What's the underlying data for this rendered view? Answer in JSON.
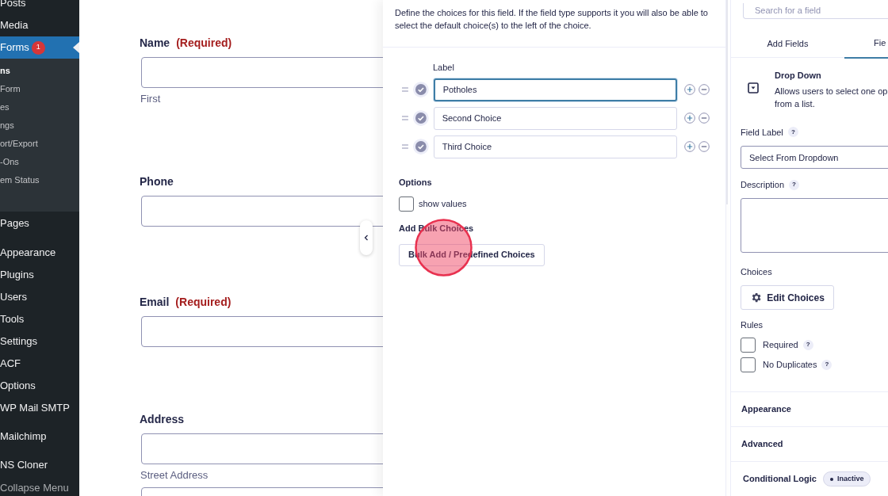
{
  "sidebar": {
    "items": [
      {
        "label": "Posts",
        "selected": false
      },
      {
        "label": "Media",
        "selected": false
      },
      {
        "label": "Forms",
        "selected": true,
        "badge": "1",
        "children": [
          {
            "label": "ns",
            "selected": true
          },
          {
            "label": "Form",
            "selected": false
          },
          {
            "label": "es",
            "selected": false
          },
          {
            "label": "ngs",
            "selected": false
          },
          {
            "label": "ort/Export",
            "selected": false
          },
          {
            "label": "-Ons",
            "selected": false
          },
          {
            "label": "em Status",
            "selected": false
          }
        ]
      },
      {
        "label": "Pages",
        "selected": false
      },
      {
        "label": "Appearance",
        "selected": false
      },
      {
        "label": "Plugins",
        "selected": false
      },
      {
        "label": "Users",
        "selected": false
      },
      {
        "label": "Tools",
        "selected": false
      },
      {
        "label": "Settings",
        "selected": false
      },
      {
        "label": "ACF",
        "selected": false
      },
      {
        "label": "Options",
        "selected": false
      },
      {
        "label": "WP Mail SMTP",
        "selected": false
      },
      {
        "label": "Mailchimp",
        "selected": false
      },
      {
        "label": "NS Cloner",
        "selected": false
      },
      {
        "label": "Collapse Menu",
        "selected": false,
        "kind": "collapse"
      }
    ]
  },
  "form": {
    "fields": [
      {
        "label": "Name",
        "required": "(Required)",
        "inputs": [
          {
            "kind": "text",
            "sublabel": "First"
          }
        ]
      },
      {
        "label": "Phone",
        "inputs": [
          {
            "kind": "text"
          }
        ]
      },
      {
        "label": "Email",
        "required": "(Required)",
        "inputs": [
          {
            "kind": "text"
          }
        ]
      },
      {
        "label": "Address",
        "inputs": [
          {
            "kind": "text",
            "sublabel": "Street Address"
          },
          {
            "kind": "text"
          }
        ]
      }
    ]
  },
  "choices_panel": {
    "description": "Define the choices for this field. If the field type supports it you will also be able to select the default choice(s) to the left of the choice.",
    "column_label": "Label",
    "choices": [
      {
        "value": "Potholes",
        "focused": true
      },
      {
        "value": "Second Choice",
        "focused": false
      },
      {
        "value": "Third Choice",
        "focused": false
      }
    ],
    "options_heading": "Options",
    "show_values": {
      "label": "show values",
      "checked": false
    },
    "bulk_heading": "Add Bulk Choices",
    "bulk_button": "Bulk Add / Predefined Choices"
  },
  "settings_panel": {
    "search": {
      "placeholder": "Search for a field"
    },
    "tabs": [
      {
        "label": "Add Fields",
        "selected": false
      },
      {
        "label": "Fie",
        "selected": true
      }
    ],
    "field_type": {
      "title": "Drop Down",
      "description_lines": [
        "Allows users to select one op",
        "from a list."
      ]
    },
    "field_label": {
      "label": "Field Label",
      "help": "?",
      "value": "Select From Dropdown"
    },
    "description": {
      "label": "Description",
      "help": "?"
    },
    "choices": {
      "label": "Choices",
      "button": "Edit Choices"
    },
    "rules": {
      "label": "Rules",
      "items": [
        {
          "label": "Required",
          "help": "?",
          "checked": false
        },
        {
          "label": "No Duplicates",
          "help": "?",
          "checked": false
        }
      ]
    },
    "sections": [
      "Appearance",
      "Advanced"
    ],
    "conditional_logic": {
      "label": "Conditional Logic",
      "status": "Inactive"
    }
  }
}
